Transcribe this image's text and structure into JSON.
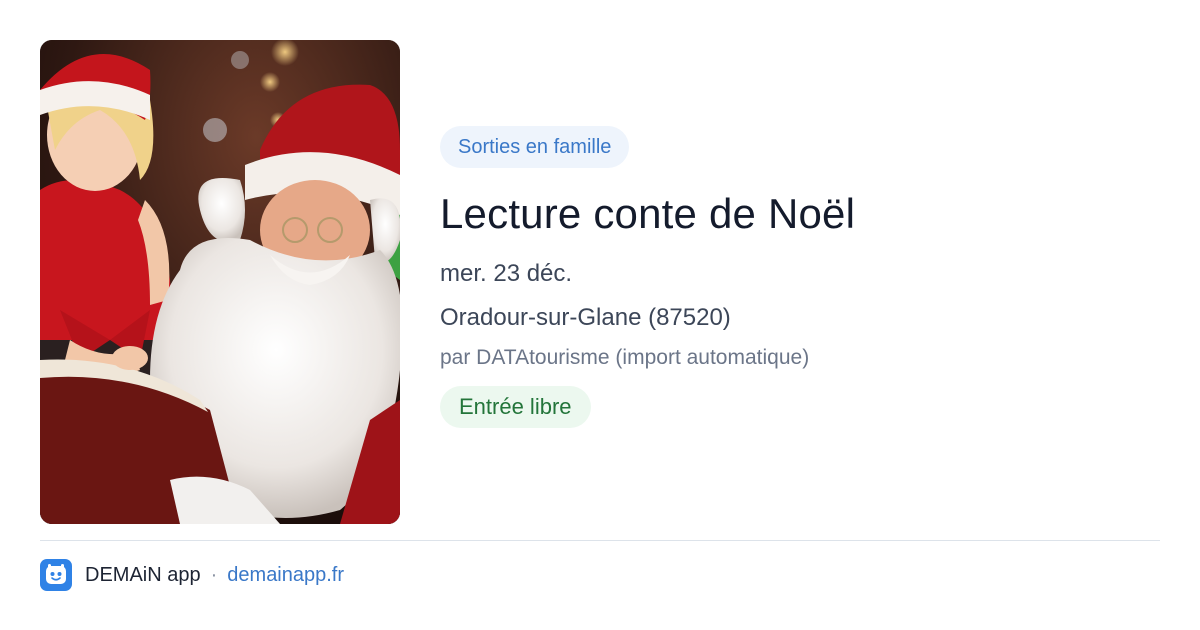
{
  "event": {
    "category": "Sorties en famille",
    "title": "Lecture conte de Noël",
    "date": "mer. 23 déc.",
    "location": "Oradour-sur-Glane (87520)",
    "author": "par DATAtourisme (import automatique)",
    "price": "Entrée libre",
    "image_icon": "santa-reading-photo"
  },
  "footer": {
    "app_name": "DEMAiN app",
    "separator": "·",
    "url": "demainapp.fr",
    "icon": "app-logo-icon"
  },
  "colors": {
    "tag_bg": "#eef4fc",
    "tag_text": "#3a78c8",
    "price_bg": "#ecf8ef",
    "price_text": "#23753a",
    "title": "#141b2c",
    "link": "#3a78c8"
  }
}
